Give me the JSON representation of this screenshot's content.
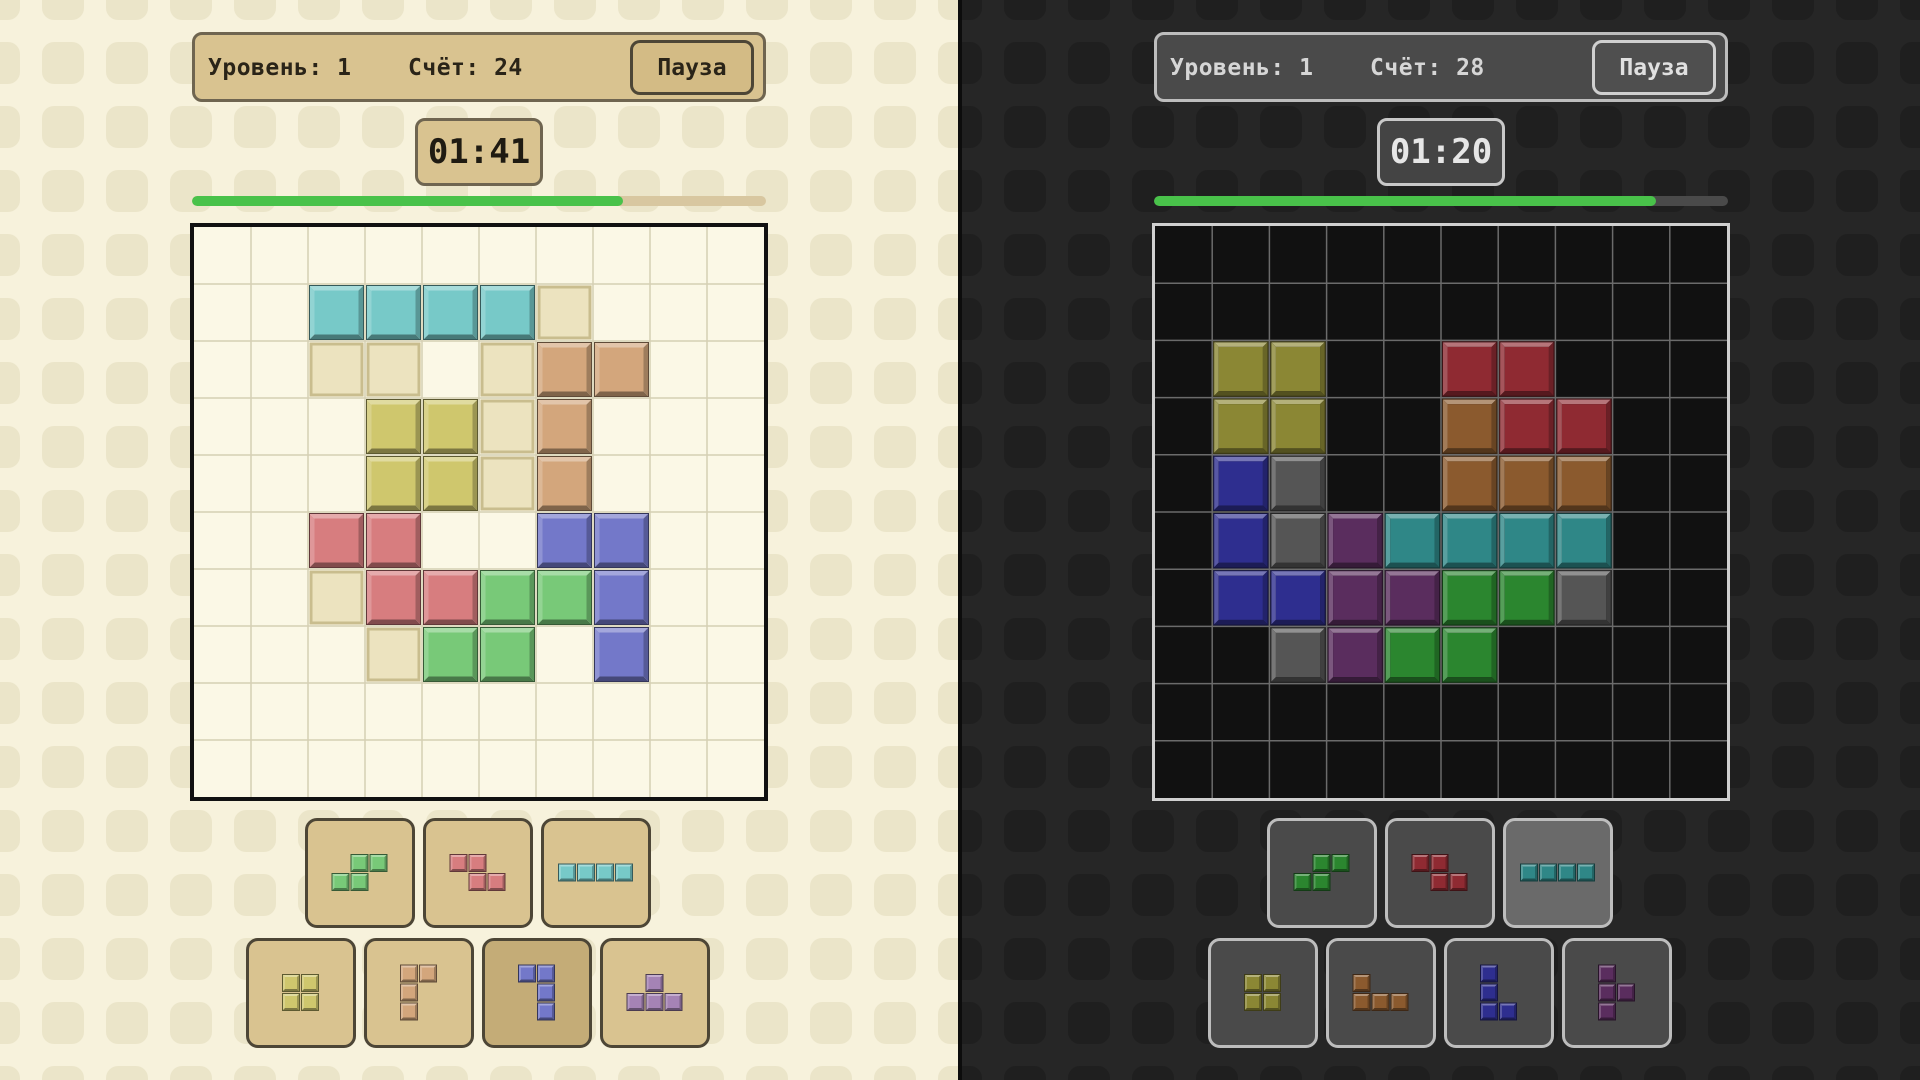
{
  "players": [
    {
      "theme": "light",
      "level_label": "Уровень: 1",
      "score_label": "Счёт: 24",
      "pause_label": "Пауза",
      "timer": "01:41",
      "progress": 0.75,
      "colors": {
        "cyan": "#77c9c8",
        "tan": "#d3a67c",
        "olive": "#cfc76d",
        "red": "#d77d7f",
        "blue": "#7378c9",
        "green": "#78c978",
        "ghost": "#ece3bf",
        "gridline": "#d5cfb4"
      },
      "cells": [
        [
          1,
          2,
          "cyan"
        ],
        [
          1,
          3,
          "cyan"
        ],
        [
          1,
          4,
          "cyan"
        ],
        [
          1,
          5,
          "cyan"
        ],
        [
          1,
          6,
          "ghost"
        ],
        [
          2,
          2,
          "ghost"
        ],
        [
          2,
          3,
          "ghost"
        ],
        [
          2,
          5,
          "ghost"
        ],
        [
          2,
          6,
          "tan"
        ],
        [
          2,
          7,
          "tan"
        ],
        [
          3,
          3,
          "olive"
        ],
        [
          3,
          4,
          "olive"
        ],
        [
          3,
          5,
          "ghost"
        ],
        [
          3,
          6,
          "tan"
        ],
        [
          4,
          3,
          "olive"
        ],
        [
          4,
          4,
          "olive"
        ],
        [
          4,
          5,
          "ghost"
        ],
        [
          4,
          6,
          "tan"
        ],
        [
          5,
          2,
          "red"
        ],
        [
          5,
          3,
          "red"
        ],
        [
          5,
          6,
          "blue"
        ],
        [
          5,
          7,
          "blue"
        ],
        [
          6,
          2,
          "ghost"
        ],
        [
          6,
          3,
          "red"
        ],
        [
          6,
          4,
          "red"
        ],
        [
          6,
          5,
          "green"
        ],
        [
          6,
          6,
          "green"
        ],
        [
          6,
          7,
          "blue"
        ],
        [
          7,
          3,
          "ghost"
        ],
        [
          7,
          4,
          "green"
        ],
        [
          7,
          5,
          "green"
        ],
        [
          7,
          7,
          "blue"
        ]
      ],
      "tray": [
        {
          "name": "s-piece",
          "color": "green",
          "shape": [
            [
              0,
              1
            ],
            [
              0,
              2
            ],
            [
              1,
              0
            ],
            [
              1,
              1
            ]
          ],
          "selected": false
        },
        {
          "name": "z-piece",
          "color": "red",
          "shape": [
            [
              0,
              0
            ],
            [
              0,
              1
            ],
            [
              1,
              1
            ],
            [
              1,
              2
            ]
          ],
          "selected": false
        },
        {
          "name": "i-piece",
          "color": "cyan",
          "shape": [
            [
              0,
              0
            ],
            [
              0,
              1
            ],
            [
              0,
              2
            ],
            [
              0,
              3
            ]
          ],
          "selected": false
        },
        {
          "name": "o-piece",
          "color": "olive",
          "shape": [
            [
              0,
              0
            ],
            [
              0,
              1
            ],
            [
              1,
              0
            ],
            [
              1,
              1
            ]
          ],
          "selected": false
        },
        {
          "name": "j-piece",
          "color": "tan",
          "shape": [
            [
              0,
              0
            ],
            [
              0,
              1
            ],
            [
              1,
              0
            ],
            [
              2,
              0
            ]
          ],
          "selected": false
        },
        {
          "name": "j-piece-rotated",
          "color": "blue",
          "shape": [
            [
              0,
              0
            ],
            [
              0,
              1
            ],
            [
              1,
              1
            ],
            [
              2,
              1
            ]
          ],
          "selected": true
        },
        {
          "name": "t-piece",
          "color": "violet",
          "shape": [
            [
              0,
              1
            ],
            [
              1,
              0
            ],
            [
              1,
              1
            ],
            [
              1,
              2
            ]
          ],
          "selected": false
        }
      ],
      "extra_colors": {
        "violet": "#a583b5"
      }
    },
    {
      "theme": "dark",
      "level_label": "Уровень: 1",
      "score_label": "Счёт: 28",
      "pause_label": "Пауза",
      "timer": "01:20",
      "progress": 0.875,
      "colors": {
        "olive": "#8b8734",
        "red": "#8f2a32",
        "tan": "#8b5a2e",
        "navy": "#2e2e8f",
        "gray": "#555555",
        "purple": "#5a2d5e",
        "teal": "#2f8787",
        "green": "#2b862f",
        "gridline": "#6b6b6b"
      },
      "cells": [
        [
          2,
          1,
          "olive"
        ],
        [
          2,
          2,
          "olive"
        ],
        [
          2,
          5,
          "red"
        ],
        [
          2,
          6,
          "red"
        ],
        [
          3,
          1,
          "olive"
        ],
        [
          3,
          2,
          "olive"
        ],
        [
          3,
          5,
          "tan"
        ],
        [
          3,
          6,
          "red"
        ],
        [
          3,
          7,
          "red"
        ],
        [
          4,
          1,
          "navy"
        ],
        [
          4,
          2,
          "gray"
        ],
        [
          4,
          5,
          "tan"
        ],
        [
          4,
          6,
          "tan"
        ],
        [
          4,
          7,
          "tan"
        ],
        [
          5,
          1,
          "navy"
        ],
        [
          5,
          2,
          "gray"
        ],
        [
          5,
          3,
          "purple"
        ],
        [
          5,
          4,
          "teal"
        ],
        [
          5,
          5,
          "teal"
        ],
        [
          5,
          6,
          "teal"
        ],
        [
          5,
          7,
          "teal"
        ],
        [
          6,
          1,
          "navy"
        ],
        [
          6,
          2,
          "navy"
        ],
        [
          6,
          3,
          "purple"
        ],
        [
          6,
          4,
          "purple"
        ],
        [
          6,
          5,
          "green"
        ],
        [
          6,
          6,
          "green"
        ],
        [
          6,
          7,
          "gray"
        ],
        [
          7,
          2,
          "gray"
        ],
        [
          7,
          3,
          "purple"
        ],
        [
          7,
          4,
          "green"
        ],
        [
          7,
          5,
          "green"
        ]
      ],
      "tray": [
        {
          "name": "s-piece",
          "color": "green",
          "shape": [
            [
              0,
              1
            ],
            [
              0,
              2
            ],
            [
              1,
              0
            ],
            [
              1,
              1
            ]
          ],
          "selected": false
        },
        {
          "name": "z-piece",
          "color": "red",
          "shape": [
            [
              0,
              0
            ],
            [
              0,
              1
            ],
            [
              1,
              1
            ],
            [
              1,
              2
            ]
          ],
          "selected": false
        },
        {
          "name": "i-piece",
          "color": "teal",
          "shape": [
            [
              0,
              0
            ],
            [
              0,
              1
            ],
            [
              0,
              2
            ],
            [
              0,
              3
            ]
          ],
          "selected": true
        },
        {
          "name": "o-piece",
          "color": "olive",
          "shape": [
            [
              0,
              0
            ],
            [
              0,
              1
            ],
            [
              1,
              0
            ],
            [
              1,
              1
            ]
          ],
          "selected": false
        },
        {
          "name": "l-piece",
          "color": "tan",
          "shape": [
            [
              0,
              0
            ],
            [
              1,
              0
            ],
            [
              1,
              1
            ],
            [
              1,
              2
            ]
          ],
          "selected": false
        },
        {
          "name": "l-piece-vertical",
          "color": "navy",
          "shape": [
            [
              0,
              0
            ],
            [
              1,
              0
            ],
            [
              2,
              0
            ],
            [
              2,
              1
            ]
          ],
          "selected": false
        },
        {
          "name": "t-piece",
          "color": "purple",
          "shape": [
            [
              0,
              0
            ],
            [
              1,
              0
            ],
            [
              1,
              1
            ],
            [
              2,
              0
            ]
          ],
          "selected": false
        }
      ],
      "extra_colors": {}
    }
  ]
}
